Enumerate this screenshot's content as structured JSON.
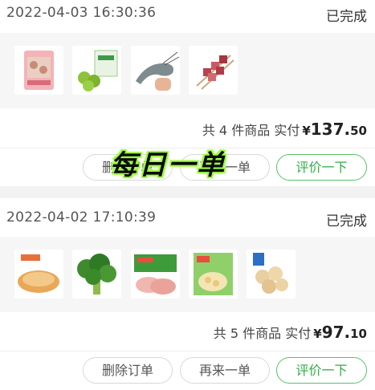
{
  "orders": [
    {
      "datetime": "2022-04-03 16:30:36",
      "status": "已完成",
      "items": [
        {
          "icon": "snack-package-icon"
        },
        {
          "icon": "green-fruit-box-icon"
        },
        {
          "icon": "shrimp-icon"
        },
        {
          "icon": "lamb-skewers-icon"
        }
      ],
      "count_prefix": "共",
      "count": "4",
      "count_suffix": "件商品",
      "paid_label": "实付",
      "currency": "¥",
      "amount_int": "137.",
      "amount_dec": "50",
      "buttons": {
        "delete": "删除订单",
        "reorder": "再来一单",
        "review": "评价一下"
      }
    },
    {
      "datetime": "2022-04-02 17:10:39",
      "status": "已完成",
      "items": [
        {
          "icon": "pastry-icon"
        },
        {
          "icon": "broccoli-icon"
        },
        {
          "icon": "ham-slices-icon"
        },
        {
          "icon": "dumpling-bag-icon"
        },
        {
          "icon": "fish-balls-icon"
        }
      ],
      "count_prefix": "共",
      "count": "5",
      "count_suffix": "件商品",
      "paid_label": "实付",
      "currency": "¥",
      "amount_int": "97.",
      "amount_dec": "10",
      "buttons": {
        "delete": "删除订单",
        "reorder": "再来一单",
        "review": "评价一下"
      }
    }
  ],
  "overlay_text": "每日一单",
  "colors": {
    "accent_green": "#2fae45",
    "overlay_glow": "#9bff3f"
  }
}
